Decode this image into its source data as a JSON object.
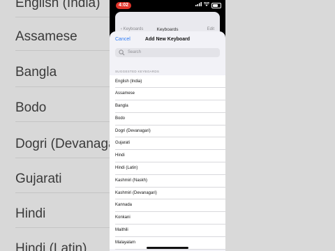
{
  "status": {
    "time": "4:02"
  },
  "underlying": {
    "back_label": "Keyboards",
    "title": "Keyboards",
    "edit_label": "Edit"
  },
  "sheet": {
    "cancel_label": "Cancel",
    "title": "Add New Keyboard",
    "search_placeholder": "Search",
    "section_header": "SUGGESTED KEYBOARDS",
    "items": [
      "English (India)",
      "Assamese",
      "Bangla",
      "Bodo",
      "Dogri (Devanagari)",
      "Gujarati",
      "Hindi",
      "Hindi (Latin)",
      "Kashmiri (Naskh)",
      "Kashmiri (Devanagari)",
      "Kannada",
      "Konkani",
      "Maithili",
      "Malayalam"
    ]
  },
  "background": {
    "rows": [
      "English (India)",
      "Assamese",
      "Bangla",
      "Bodo",
      "Dogri (Devanagari)",
      "Gujarati",
      "Hindi",
      "Hindi (Latin)"
    ]
  },
  "colors": {
    "accent": "#2f7cf6",
    "recording": "#e0352b"
  }
}
